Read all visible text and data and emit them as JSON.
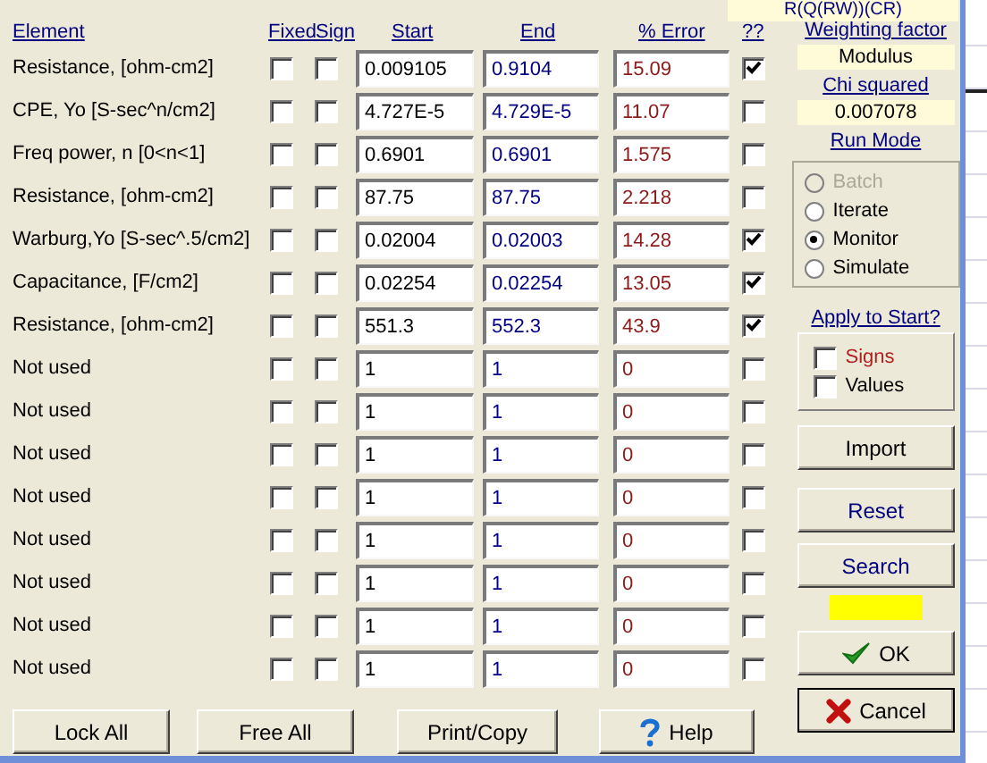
{
  "model_label": "R(Q(RW))(CR)",
  "columns": [
    "Element",
    "Fixed",
    "Sign",
    "Start",
    "End",
    "% Error",
    "??"
  ],
  "rows": [
    {
      "element": "Resistance,  [ohm-cm2]",
      "fixed": false,
      "sign": false,
      "start": "0.009105",
      "end": "0.9104",
      "error": "15.09",
      "flagged": true
    },
    {
      "element": "CPE, Yo [S-sec^n/cm2]",
      "fixed": false,
      "sign": false,
      "start": "4.727E-5",
      "end": "4.729E-5",
      "error": "11.07",
      "flagged": false
    },
    {
      "element": "Freq power, n  [0<n<1]",
      "fixed": false,
      "sign": false,
      "start": "0.6901",
      "end": "0.6901",
      "error": "1.575",
      "flagged": false
    },
    {
      "element": "Resistance,  [ohm-cm2]",
      "fixed": false,
      "sign": false,
      "start": "87.75",
      "end": "87.75",
      "error": "2.218",
      "flagged": false
    },
    {
      "element": "Warburg,Yo [S-sec^.5/cm2]",
      "fixed": false,
      "sign": false,
      "start": "0.02004",
      "end": "0.02003",
      "error": "14.28",
      "flagged": true
    },
    {
      "element": "Capacitance,  [F/cm2]",
      "fixed": false,
      "sign": false,
      "start": "0.02254",
      "end": "0.02254",
      "error": "13.05",
      "flagged": true
    },
    {
      "element": "Resistance,  [ohm-cm2]",
      "fixed": false,
      "sign": false,
      "start": "551.3",
      "end": "552.3",
      "error": "43.9",
      "flagged": true
    },
    {
      "element": "Not used",
      "fixed": false,
      "sign": false,
      "start": "1",
      "end": "1",
      "error": "0",
      "flagged": false
    },
    {
      "element": "Not used",
      "fixed": false,
      "sign": false,
      "start": "1",
      "end": "1",
      "error": "0",
      "flagged": false
    },
    {
      "element": "Not used",
      "fixed": false,
      "sign": false,
      "start": "1",
      "end": "1",
      "error": "0",
      "flagged": false
    },
    {
      "element": "Not used",
      "fixed": false,
      "sign": false,
      "start": "1",
      "end": "1",
      "error": "0",
      "flagged": false
    },
    {
      "element": "Not used",
      "fixed": false,
      "sign": false,
      "start": "1",
      "end": "1",
      "error": "0",
      "flagged": false
    },
    {
      "element": "Not used",
      "fixed": false,
      "sign": false,
      "start": "1",
      "end": "1",
      "error": "0",
      "flagged": false
    },
    {
      "element": "Not used",
      "fixed": false,
      "sign": false,
      "start": "1",
      "end": "1",
      "error": "0",
      "flagged": false
    },
    {
      "element": "Not used",
      "fixed": false,
      "sign": false,
      "start": "1",
      "end": "1",
      "error": "0",
      "flagged": false
    }
  ],
  "weighting": {
    "label": "Weighting factor",
    "value": "Modulus"
  },
  "chi": {
    "label": "Chi squared",
    "value": "0.007078"
  },
  "run_mode": {
    "label": "Run Mode",
    "options": [
      {
        "label": "Batch",
        "selected": false,
        "disabled": true
      },
      {
        "label": "Iterate",
        "selected": false,
        "disabled": false
      },
      {
        "label": "Monitor",
        "selected": true,
        "disabled": false
      },
      {
        "label": "Simulate",
        "selected": false,
        "disabled": false
      }
    ]
  },
  "apply": {
    "label": "Apply to Start?",
    "options": [
      {
        "label": "Signs",
        "checked": false,
        "color": "#b02020"
      },
      {
        "label": "Values",
        "checked": false,
        "color": "#000000"
      }
    ]
  },
  "side_buttons": [
    {
      "label": "Import",
      "color": "#000000"
    },
    {
      "label": "Reset",
      "color": "#000080"
    },
    {
      "label": "Search",
      "color": "#000080"
    }
  ],
  "ok": "OK",
  "cancel": "Cancel",
  "bottom_buttons": [
    "Lock All",
    "Free All",
    "Print/Copy",
    "Help"
  ]
}
